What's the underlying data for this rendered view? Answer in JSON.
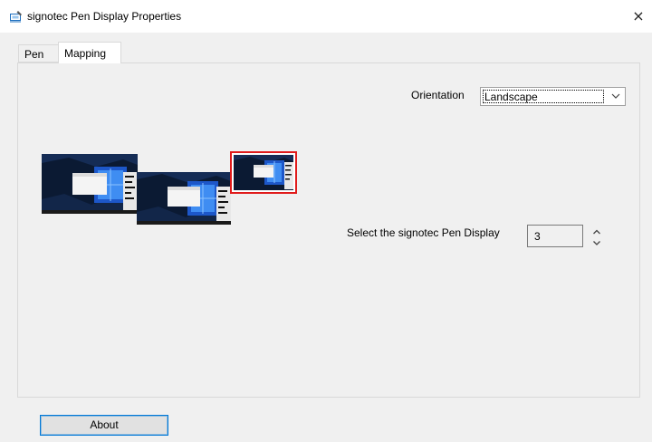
{
  "window": {
    "title": "signotec Pen Display Properties",
    "close_glyph": "×"
  },
  "tabs": [
    {
      "label": "Pen",
      "selected": false
    },
    {
      "label": "Mapping",
      "selected": true
    }
  ],
  "mapping": {
    "orientation_label": "Orientation",
    "orientation_value": "Landscape",
    "select_label": "Select the signotec Pen Display",
    "selected_display": "3",
    "highlight_color": "#e01b1b"
  },
  "icons": {
    "app": "pen-display-icon",
    "close": "close-icon",
    "dropdown": "chevron-down-icon",
    "spin_up": "chevron-up-icon",
    "spin_down": "chevron-down-icon"
  },
  "footer": {
    "about_label": "About"
  }
}
